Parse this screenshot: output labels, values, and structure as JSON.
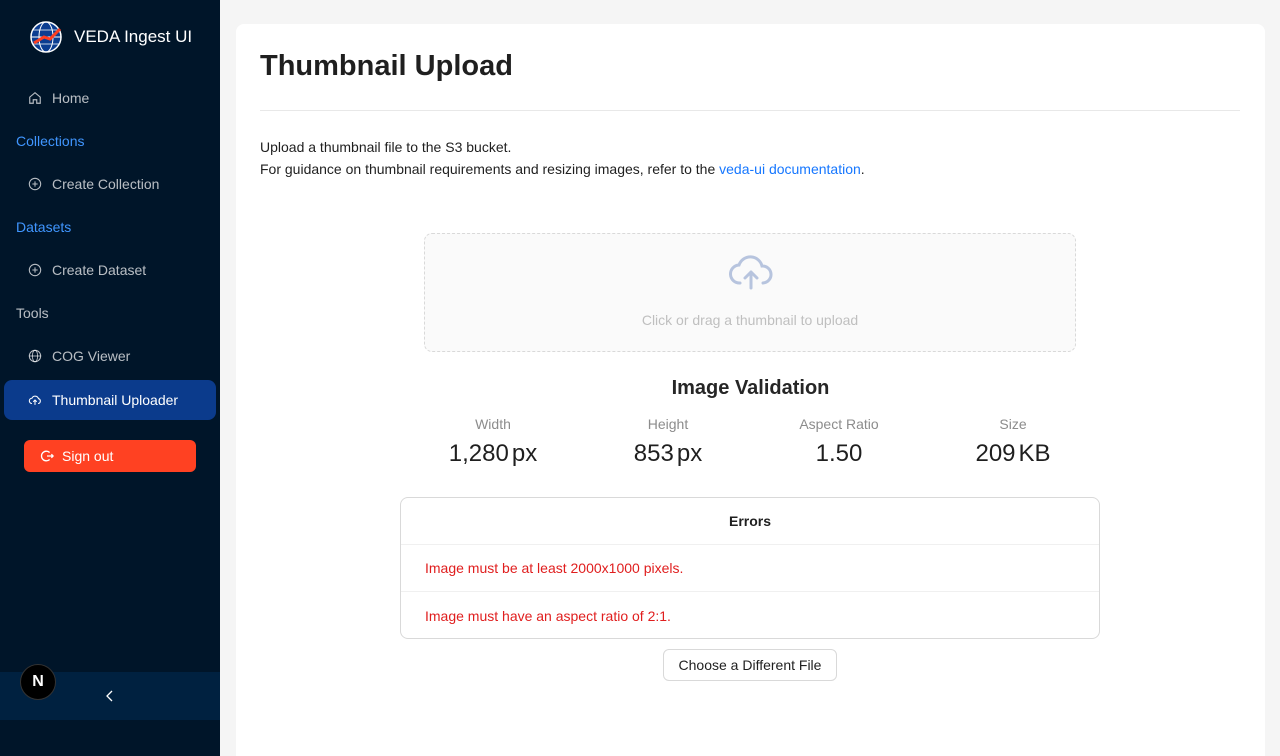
{
  "app": {
    "title": "VEDA Ingest UI",
    "logo_icon": "globe-logo-icon"
  },
  "sidebar": {
    "home": "Home",
    "collections_group": "Collections",
    "create_collection": "Create Collection",
    "datasets_group": "Datasets",
    "create_dataset": "Create Dataset",
    "tools_group": "Tools",
    "cog_viewer": "COG Viewer",
    "thumbnail_uploader": "Thumbnail Uploader",
    "sign_out": "Sign out",
    "next_badge": "N"
  },
  "colors": {
    "sidebar_bg": "#001529",
    "active_item": "#0b3b8c",
    "signout": "#ff4122",
    "link": "#1677ff",
    "error": "#e01e1e"
  },
  "main": {
    "title": "Thumbnail Upload",
    "intro_line1": "Upload a thumbnail file to the S3 bucket.",
    "intro_line2_prefix": "For guidance on thumbnail requirements and resizing images, refer to the ",
    "intro_link": "veda-ui documentation",
    "intro_line2_suffix": ".",
    "dropzone_hint": "Click or drag a thumbnail to upload",
    "validation_title": "Image Validation",
    "stats": [
      {
        "label": "Width",
        "value": "1,280",
        "unit": "px"
      },
      {
        "label": "Height",
        "value": "853",
        "unit": "px"
      },
      {
        "label": "Aspect Ratio",
        "value": "1.50",
        "unit": ""
      },
      {
        "label": "Size",
        "value": "209",
        "unit": "KB"
      }
    ],
    "errors_title": "Errors",
    "errors": [
      "Image must be at least 2000x1000 pixels.",
      "Image must have an aspect ratio of 2:1."
    ],
    "choose_button": "Choose a Different File"
  }
}
